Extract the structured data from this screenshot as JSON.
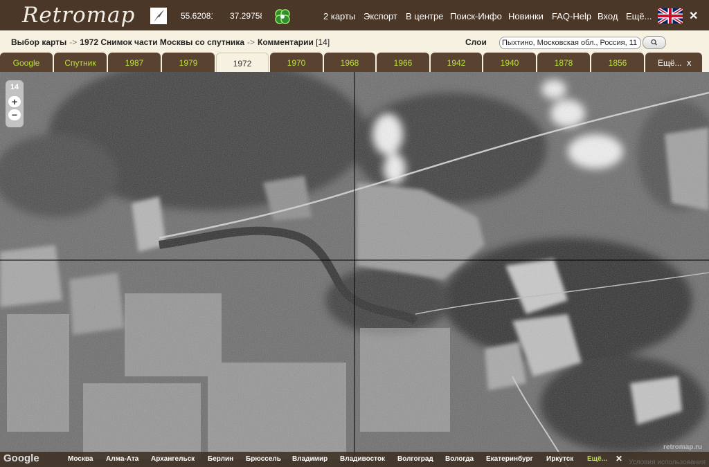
{
  "header": {
    "logo": "Retromap",
    "lat": "55.62081",
    "lon": "37.29758",
    "menu": [
      "2 карты",
      "Экспорт",
      "В центре",
      "Поиск-Инфо",
      "Новинки",
      "FAQ-Help",
      "Вход",
      "Ещё..."
    ],
    "close": "✕"
  },
  "breadcrumb": {
    "item1": "Выбор карты",
    "sep": "->",
    "item2": "1972 Снимок части Москвы со спутника",
    "item3": "Комментарии",
    "count": "[14]"
  },
  "layers": {
    "label": "Слои",
    "search_value": "Пыхтино, Московская обл., Россия, 11",
    "search_icon": "search-icon"
  },
  "tabs": [
    {
      "label": "Google",
      "active": false
    },
    {
      "label": "Спутник",
      "active": false
    },
    {
      "label": "1987",
      "active": false
    },
    {
      "label": "1979",
      "active": false
    },
    {
      "label": "1972",
      "active": true
    },
    {
      "label": "1970",
      "active": false
    },
    {
      "label": "1968",
      "active": false
    },
    {
      "label": "1966",
      "active": false
    },
    {
      "label": "1942",
      "active": false
    },
    {
      "label": "1940",
      "active": false
    },
    {
      "label": "1878",
      "active": false
    },
    {
      "label": "1856",
      "active": false
    },
    {
      "label": "Ещё...",
      "active": false
    }
  ],
  "tab_close": "x",
  "map": {
    "zoom_level": "14",
    "zoom_in": "+",
    "zoom_out": "−",
    "watermark": "retromap.ru"
  },
  "footer": {
    "google": "Google",
    "cities": [
      "Москва",
      "Алма-Ата",
      "Архангельск",
      "Берлин",
      "Брюссель",
      "Владимир",
      "Владивосток",
      "Волгоград",
      "Вологда",
      "Екатеринбург",
      "Иркутск"
    ],
    "more": "Ещё...",
    "close": "✕",
    "terms": "Условия использования"
  },
  "colors": {
    "header_bg": "#4a3727",
    "tab_bg": "#5a4230",
    "tab_text": "#b9e03b",
    "crumb_bg": "#f6f1e1"
  }
}
